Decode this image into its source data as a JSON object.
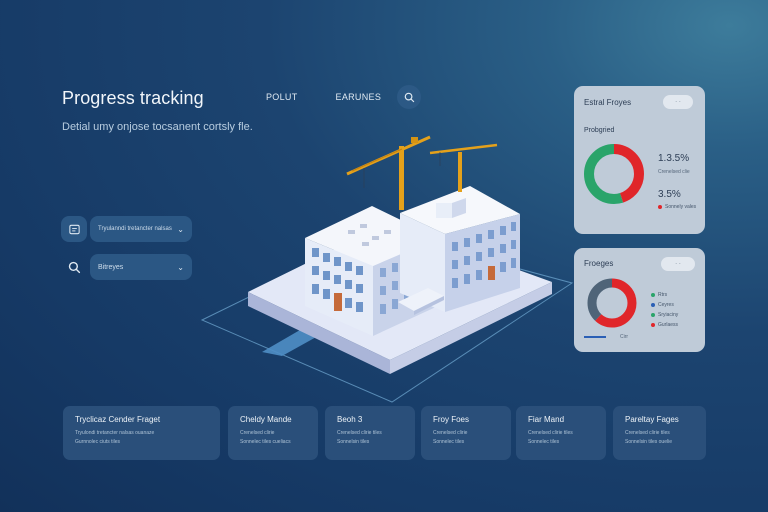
{
  "header": {
    "title": "Progress tracking",
    "subtitle": "Detial umy onjose tocsanent cortsly fle.",
    "nav": [
      "POLUT",
      "EARUNES"
    ]
  },
  "sidebar": {
    "items": [
      {
        "label": "Tryulanndi tretancter nalsas"
      },
      {
        "label": "Bitreyes"
      }
    ]
  },
  "card_status": {
    "title": "Estral Froyes",
    "pill": "· ·",
    "subtitle": "Probgried",
    "value_1": "1.3.5%",
    "value_1_caption": "Crenelsed clie",
    "value_2": "3.5%",
    "value_2_caption": "Sonnely vales",
    "donut": {
      "green": 0.55,
      "red": 0.45
    },
    "colors": {
      "green": "#2aa46a",
      "red": "#e0262a"
    }
  },
  "card_progress": {
    "title": "Froeges",
    "pill": "· ·",
    "legend": [
      "Rtrs",
      "Ceyres",
      "Sryiaciny",
      "Gurlaess"
    ],
    "footer": "Cirr",
    "donut": {
      "red": 0.62,
      "slate": 0.38
    },
    "colors": {
      "red": "#e0262a",
      "slate": "#4f6478",
      "green": "#2aa46a",
      "blue": "#2a5fb5"
    }
  },
  "bottom_cards": [
    {
      "title": "Tryclicaz Cender Fraget",
      "lines": [
        "Tryulondi tretancter nalsas ouanaze",
        "Gurnnolec ciuts tiles"
      ]
    },
    {
      "title": "Cheldy Mande",
      "lines": [
        "Crenelsed clirie",
        "Sonnelec tiles cueliacs"
      ]
    },
    {
      "title": "Beoh 3",
      "lines": [
        "Crenelsed clirie tiles",
        "Sonnelsin tiles"
      ]
    },
    {
      "title": "Froy Foes",
      "lines": [
        "Crenelsed clirie",
        "Sonnelec tiles"
      ]
    },
    {
      "title": "Fiar Mand",
      "lines": [
        "Crenelsed clirie tiles",
        "Sonnelec tiles"
      ]
    },
    {
      "title": "Pareltay Fages",
      "lines": [
        "Crenelsed clirie tiles",
        "Sonnelsin tiles ouelie"
      ]
    }
  ],
  "icons": [
    "search-icon",
    "document-icon",
    "chevron-down-icon",
    "construction-crane-icon"
  ]
}
